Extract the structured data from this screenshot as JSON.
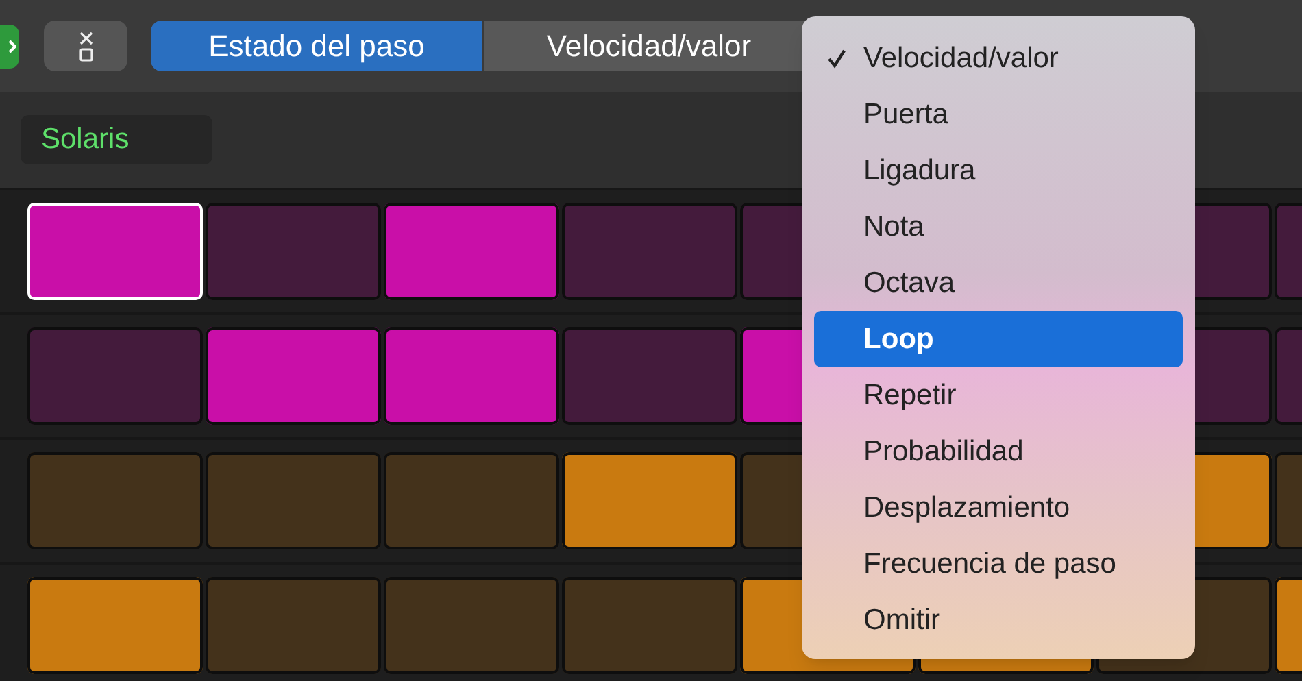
{
  "toolbar": {
    "tabs": [
      {
        "label": "Estado del paso",
        "selected": true
      },
      {
        "label": "Velocidad/valor",
        "selected": false
      }
    ]
  },
  "pattern": {
    "name": "Solaris"
  },
  "rows": [
    {
      "color": "#c90fa8",
      "steps": [
        {
          "on": true,
          "selected": true
        },
        {
          "on": false,
          "selected": false
        },
        {
          "on": true,
          "selected": false
        },
        {
          "on": false,
          "selected": false
        },
        {
          "on": false,
          "selected": false
        },
        {
          "on": false,
          "selected": false
        },
        {
          "on": false,
          "selected": false
        }
      ]
    },
    {
      "color": "#c90fa8",
      "steps": [
        {
          "on": false,
          "selected": false
        },
        {
          "on": true,
          "selected": false
        },
        {
          "on": true,
          "selected": false
        },
        {
          "on": false,
          "selected": false
        },
        {
          "on": true,
          "selected": false
        },
        {
          "on": false,
          "selected": false
        },
        {
          "on": false,
          "selected": false
        }
      ]
    },
    {
      "color": "#c97a10",
      "steps": [
        {
          "on": false,
          "selected": false
        },
        {
          "on": false,
          "selected": false
        },
        {
          "on": false,
          "selected": false
        },
        {
          "on": true,
          "selected": false
        },
        {
          "on": false,
          "selected": false
        },
        {
          "on": true,
          "selected": false
        },
        {
          "on": false,
          "selected": false
        }
      ]
    },
    {
      "color": "#c97a10",
      "steps": [
        {
          "on": true,
          "selected": false
        },
        {
          "on": false,
          "selected": false
        },
        {
          "on": false,
          "selected": false
        },
        {
          "on": false,
          "selected": false
        },
        {
          "on": true,
          "selected": false
        },
        {
          "on": true,
          "selected": false
        },
        {
          "on": false,
          "selected": false
        },
        {
          "on": true,
          "selected": false
        }
      ]
    }
  ],
  "menu": {
    "items": [
      {
        "label": "Velocidad/valor",
        "checked": true,
        "highlighted": false
      },
      {
        "label": "Puerta",
        "checked": false,
        "highlighted": false
      },
      {
        "label": "Ligadura",
        "checked": false,
        "highlighted": false
      },
      {
        "label": "Nota",
        "checked": false,
        "highlighted": false
      },
      {
        "label": "Octava",
        "checked": false,
        "highlighted": false
      },
      {
        "label": "Loop",
        "checked": false,
        "highlighted": true
      },
      {
        "label": "Repetir",
        "checked": false,
        "highlighted": false
      },
      {
        "label": "Probabilidad",
        "checked": false,
        "highlighted": false
      },
      {
        "label": "Desplazamiento",
        "checked": false,
        "highlighted": false
      },
      {
        "label": "Frecuencia de paso",
        "checked": false,
        "highlighted": false
      },
      {
        "label": "Omitir",
        "checked": false,
        "highlighted": false
      }
    ]
  }
}
